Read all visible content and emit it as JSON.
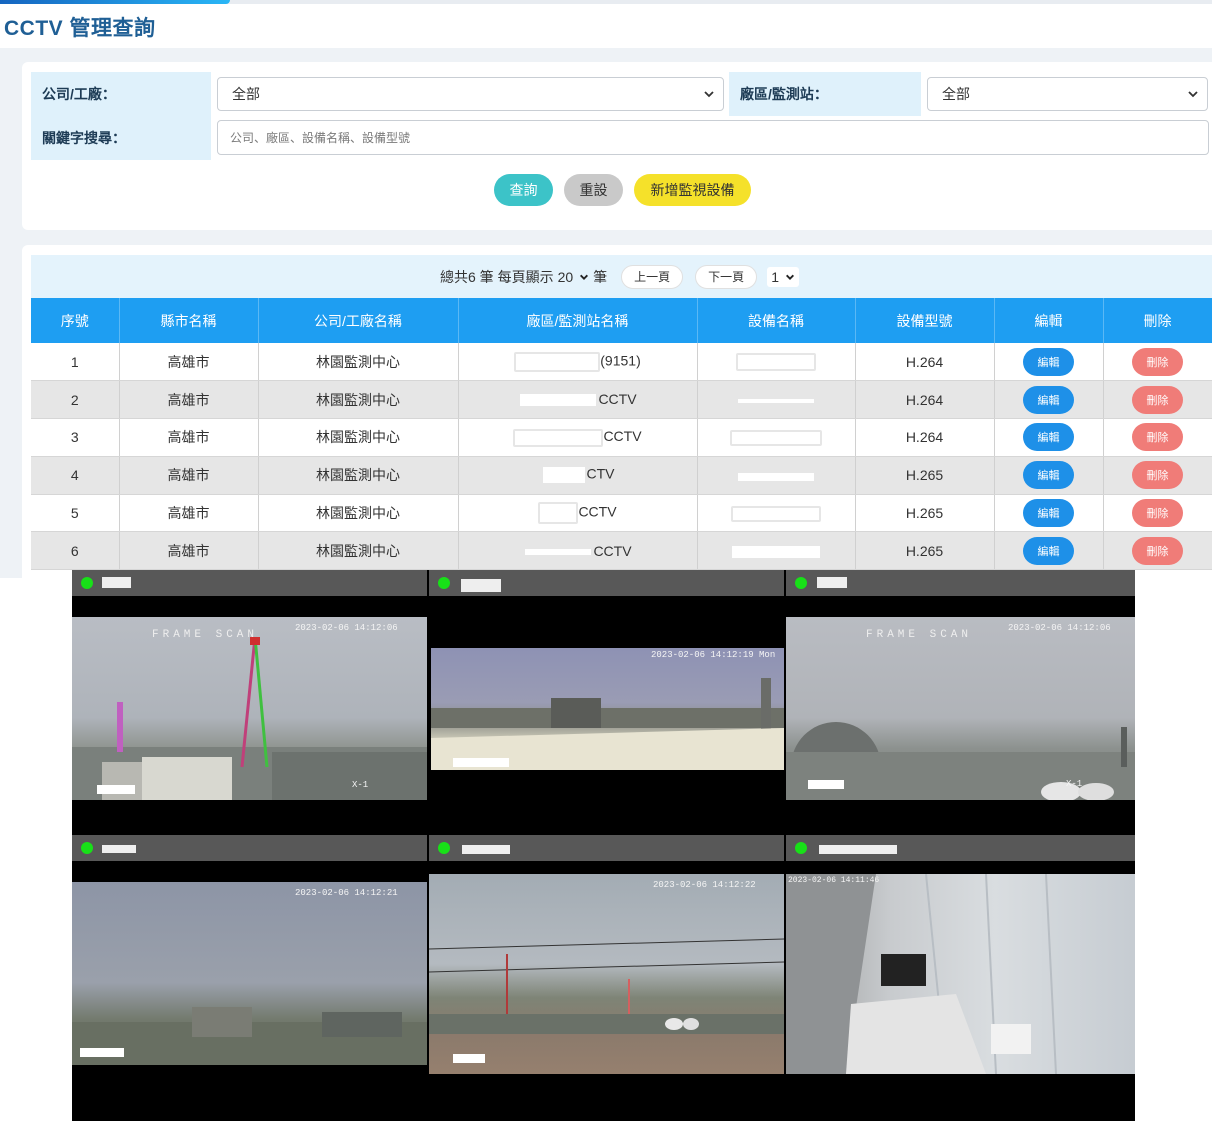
{
  "page": {
    "title": "CCTV 管理查詢"
  },
  "filters": {
    "company_label": "公司/工廠：",
    "company_value": "全部",
    "station_label": "廠區/監測站：",
    "station_value": "全部",
    "keyword_label": "關鍵字搜尋：",
    "keyword_placeholder": "公司、廠區、設備名稱、設備型號"
  },
  "actions": {
    "search_label": "查詢",
    "reset_label": "重設",
    "add_label": "新增監視設備"
  },
  "colors": {
    "header_blue": "#1e9ef2",
    "search_btn": "#3cc3c8",
    "reset_btn": "#c9c9c9",
    "add_btn": "#f5e12a",
    "edit_btn": "#1e90e8",
    "delete_btn": "#f07c78",
    "online_dot": "#18e018"
  },
  "pager": {
    "total_prefix": "總共6 筆 每頁顯示",
    "page_size": "20",
    "unit": "筆",
    "prev_label": "上一頁",
    "next_label": "下一頁",
    "page_value": "1"
  },
  "table": {
    "headers": [
      "序號",
      "縣市名稱",
      "公司/工廠名稱",
      "廠區/監測站名稱",
      "設備名稱",
      "設備型號",
      "編輯",
      "刪除"
    ],
    "edit_label": "編輯",
    "delete_label": "刪除",
    "rows": [
      {
        "no": "1",
        "city": "高雄市",
        "company": "林園監測中心",
        "station_suffix": "(9151)",
        "model": "H.264"
      },
      {
        "no": "2",
        "city": "高雄市",
        "company": "林園監測中心",
        "station_suffix": "CCTV",
        "model": "H.264"
      },
      {
        "no": "3",
        "city": "高雄市",
        "company": "林園監測中心",
        "station_suffix": "CCTV",
        "model": "H.264"
      },
      {
        "no": "4",
        "city": "高雄市",
        "company": "林園監測中心",
        "station_suffix": "CTV",
        "model": "H.265"
      },
      {
        "no": "5",
        "city": "高雄市",
        "company": "林園監測中心",
        "station_suffix": "CCTV",
        "model": "H.265"
      },
      {
        "no": "6",
        "city": "高雄市",
        "company": "林園監測中心",
        "station_suffix": "CCTV",
        "model": "H.265"
      }
    ]
  },
  "cameras": [
    {
      "timestamp": "2023-02-06 14:12:06",
      "brand": "FRAME SCAN",
      "overlay": "X-1"
    },
    {
      "timestamp": "2023-02-06 14:12:19 Mon",
      "brand": "",
      "overlay": ""
    },
    {
      "timestamp": "2023-02-06 14:12:06",
      "brand": "FRAME SCAN",
      "overlay": "X-1"
    },
    {
      "timestamp": "2023-02-06 14:12:21",
      "brand": "",
      "overlay": ""
    },
    {
      "timestamp": "2023-02-06 14:12:22",
      "brand": "",
      "overlay": ""
    },
    {
      "timestamp": "2023-02-06 14:11:46",
      "brand": "",
      "overlay": ""
    }
  ]
}
